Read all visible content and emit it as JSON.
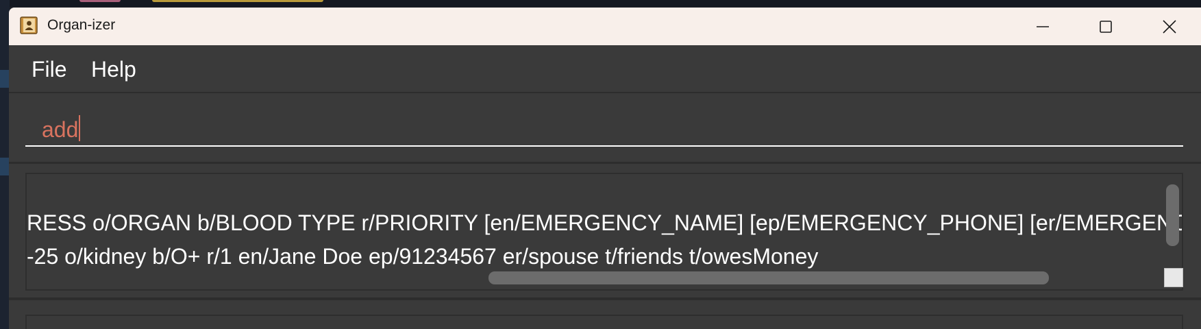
{
  "window": {
    "title": "Organ-izer"
  },
  "menu": {
    "items": [
      "File",
      "Help"
    ]
  },
  "command_box": {
    "value": "add"
  },
  "result_display": {
    "lines": [
      "RESS o/ORGAN b/BLOOD TYPE r/PRIORITY [en/EMERGENCY_NAME] [ep/EMERGENCY_PHONE] [er/EMERGENCY_R",
      "-25 o/kidney b/O+ r/1 en/Jane Doe ep/91234567 er/spouse t/friends t/owesMoney"
    ]
  },
  "colors": {
    "titlebar": "#f8efea",
    "panel": "#3a3a3a",
    "command_text": "#d9735f",
    "text": "#ffffff"
  },
  "icons": {
    "app": "contact-book-icon",
    "minimize": "minimize-icon",
    "maximize": "maximize-icon",
    "close": "close-icon"
  }
}
